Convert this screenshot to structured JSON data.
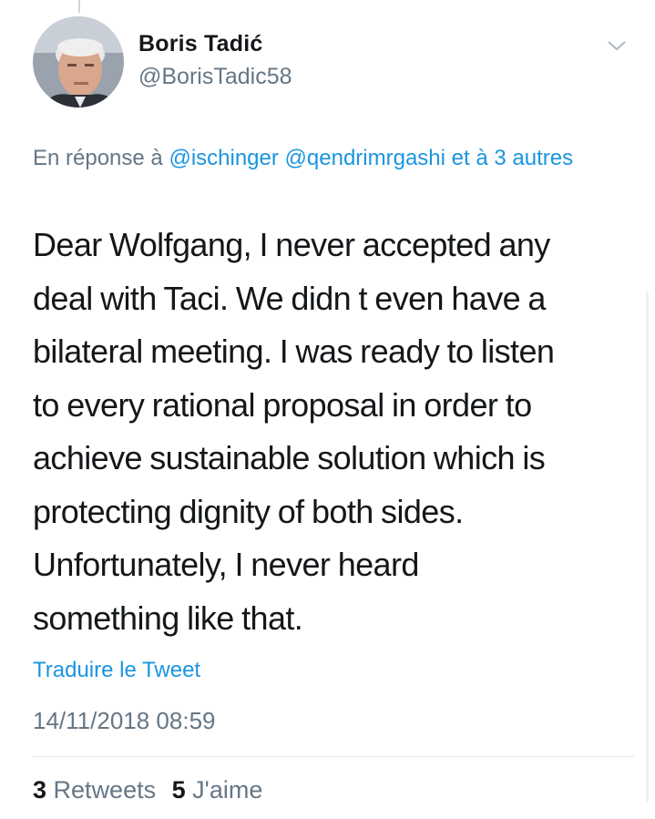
{
  "author": {
    "display_name": "Boris Tadić",
    "handle": "@BorisTadic58"
  },
  "reply": {
    "prefix": "En réponse à",
    "mention_1": "@ischinger",
    "mention_2": "@qendrimrgashi",
    "suffix": "et à 3 autres"
  },
  "tweet": {
    "lines": [
      "Dear Wolfgang, I never accepted any",
      "deal with Taci. We didn t even have a",
      "bilateral meeting. I was ready to listen",
      "to every rational proposal in order to",
      "achieve sustainable solution which is",
      "protecting dignity of both sides.",
      "Unfortunately, I never heard",
      "something like that."
    ],
    "translate_label": "Traduire le Tweet",
    "timestamp": "14/11/2018 08:59"
  },
  "stats": {
    "retweets_count": "3",
    "retweets_label": "Retweets",
    "likes_count": "5",
    "likes_label": "J'aime"
  },
  "icons": {
    "menu": "chevron-down-icon"
  },
  "colors": {
    "link": "#1b95e0",
    "secondary_text": "#657786",
    "primary_text": "#14171a",
    "divider": "#e1e8ed"
  }
}
